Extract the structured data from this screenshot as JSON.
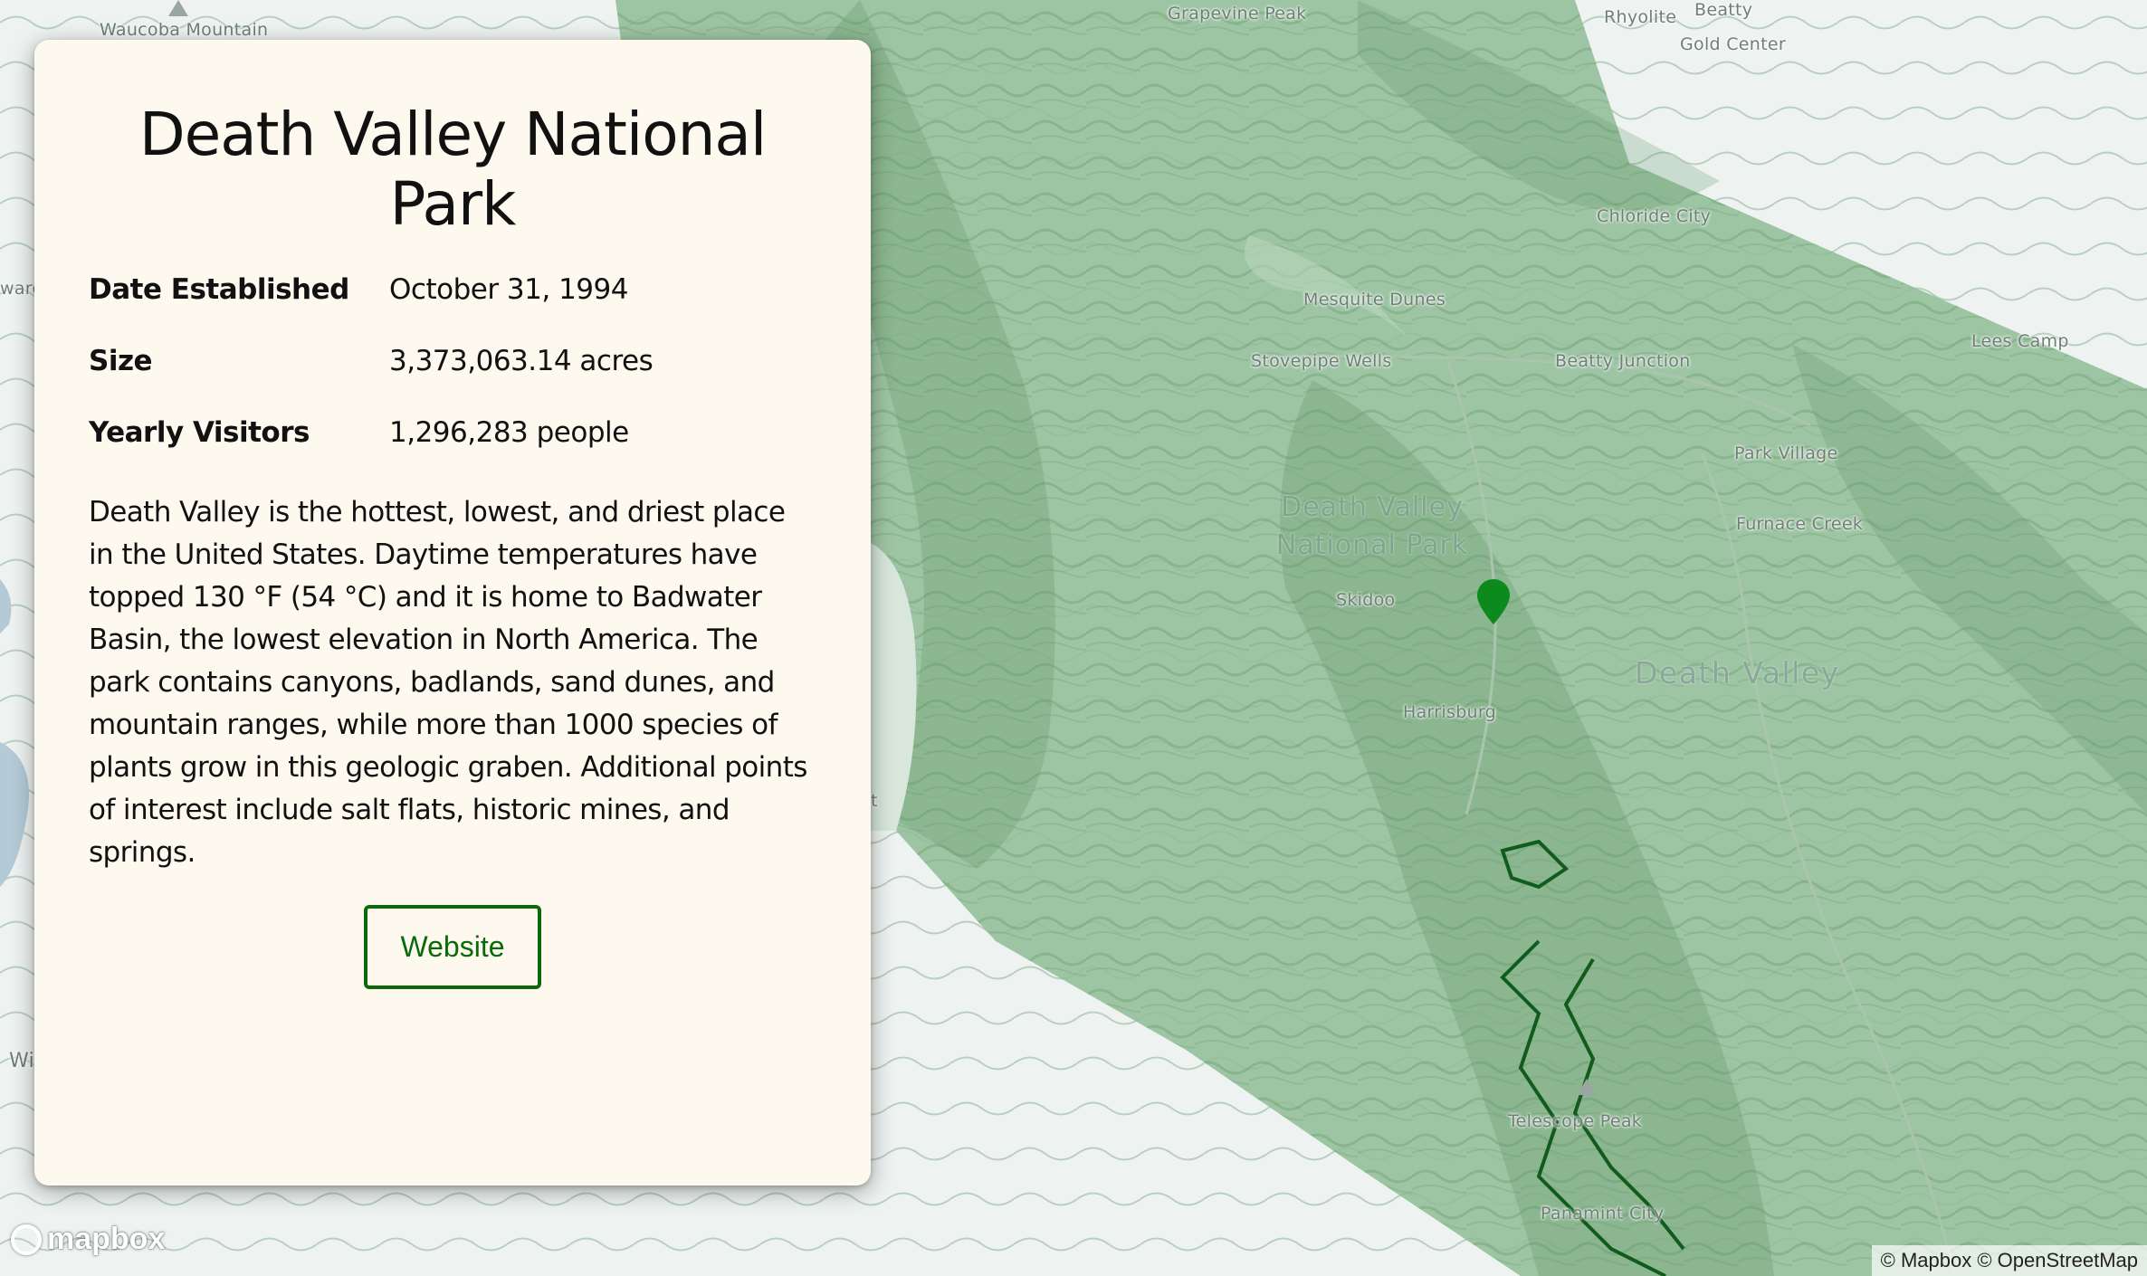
{
  "park": {
    "name": "Death Valley National Park",
    "info": [
      {
        "label": "Date Established",
        "value": "October 31, 1994"
      },
      {
        "label": "Size",
        "value": "3,373,063.14 acres"
      },
      {
        "label": "Yearly Visitors",
        "value": "1,296,283 people"
      }
    ],
    "description": "Death Valley is the hottest, lowest, and driest place in the United States. Daytime temperatures have topped 130 °F (54 °C) and it is home to Badwater Basin, the lowest elevation in North America. The park contains canyons, badlands, sand dunes, and mountain ranges, while more than 1000 species of plants grow in this geologic graben. Additional points of interest include salt flats, historic mines, and springs.",
    "website_label": "Website"
  },
  "map": {
    "labels": {
      "waucoba": "Waucoba Mountain",
      "grapevine": "Grapevine Peak",
      "rhyolite": "Rhyolite",
      "beatty": "Beatty",
      "gold_center": "Gold Center",
      "chloride_city": "Chloride City",
      "mesquite_dunes": "Mesquite Dunes",
      "stovepipe_wells": "Stovepipe Wells",
      "beatty_junction": "Beatty Junction",
      "lees_camp": "Lees Camp",
      "park_village": "Park Village",
      "furnace_creek": "Furnace Creek",
      "park_region": "Death Valley National Park",
      "skidoo": "Skidoo",
      "harrisburg": "Harrisburg",
      "death_valley": "Death Valley",
      "telescope_peak": "Telescope Peak",
      "panamint_city": "Panamint City",
      "edge_ward": "ward",
      "edge_wi": "Wi",
      "edge_t": "t"
    },
    "colors": {
      "park_fill": "#8fbc95",
      "terrain": "#5f9466",
      "water": "#b4cbd7",
      "marker": "#0d8a1e",
      "boundary": "#115c1c"
    },
    "logo_text": "mapbox",
    "attribution": "© Mapbox © OpenStreetMap"
  }
}
